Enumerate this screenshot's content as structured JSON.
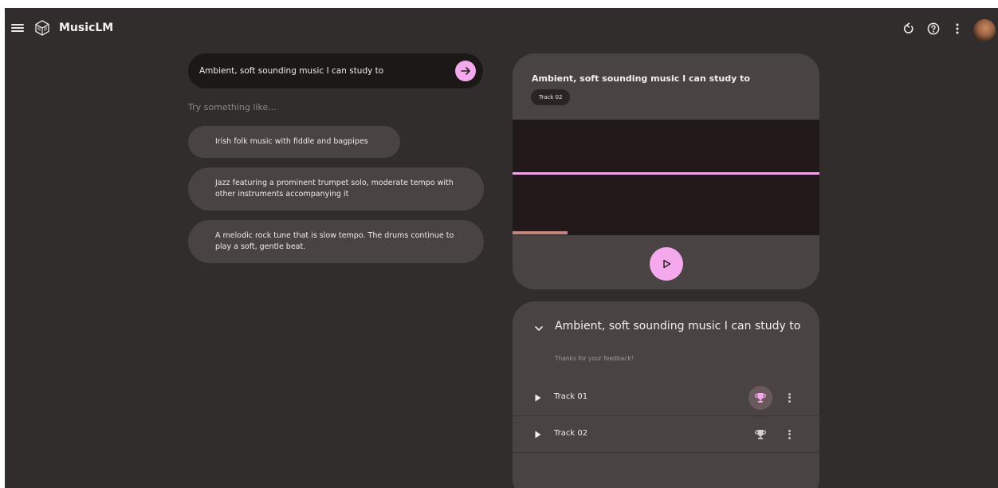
{
  "app": {
    "title": "MusicLM"
  },
  "prompt": {
    "value": "Ambient, soft sounding music I can study to",
    "placeholder": ""
  },
  "suggestions": {
    "label": "Try something like...",
    "items": [
      "Irish folk music with fiddle and bagpipes",
      "Jazz featuring a prominent trumpet solo, moderate tempo with other instruments accompanying it",
      "A melodic rock tune that is slow tempo. The drums continue to play a soft, gentle beat."
    ]
  },
  "player": {
    "title": "Ambient, soft sounding music I can study to",
    "track_chip": "Track 02",
    "progress": 0.18
  },
  "results": {
    "title": "Ambient, soft sounding music I can study to",
    "feedback": "Thanks for your feedback!",
    "tracks": [
      {
        "name": "Track 01",
        "selected": true
      },
      {
        "name": "Track 02",
        "selected": false
      }
    ]
  },
  "icons": {
    "menu": "menu-icon",
    "logo": "musiclm-logo-icon",
    "refresh": "refresh-icon",
    "help": "help-icon",
    "more": "more-vert-icon",
    "submit": "arrow-right-icon",
    "play": "play-icon",
    "collapse": "chevron-down-icon",
    "trophy": "trophy-icon"
  },
  "colors": {
    "background": "#322d2d",
    "card": "#4a4343",
    "accent": "#f4a9ec",
    "waveform": "#221a1a",
    "progress": "#c4877f"
  }
}
